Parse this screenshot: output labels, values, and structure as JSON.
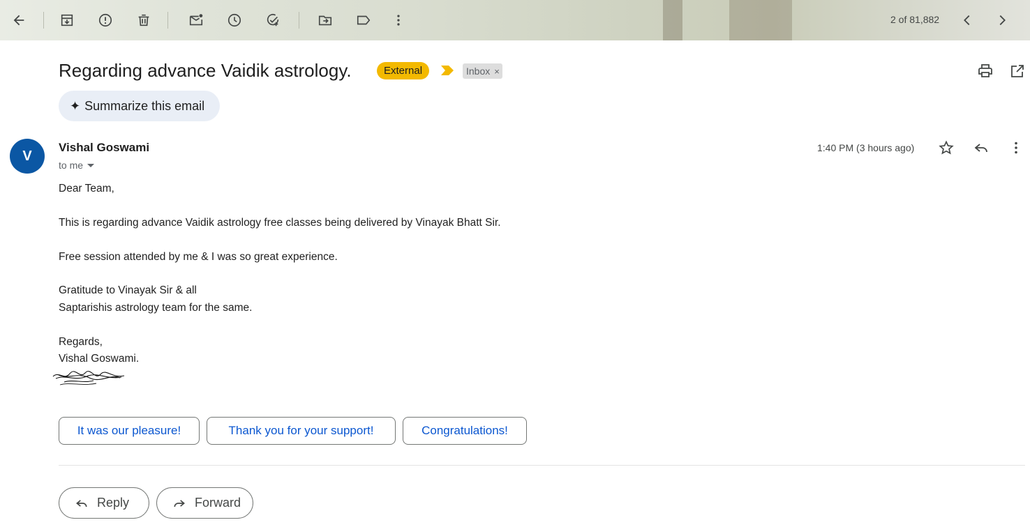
{
  "toolbar": {
    "pager": "2 of 81,882",
    "icons": [
      "back-icon",
      "archive-icon",
      "report-spam-icon",
      "delete-icon",
      "mark-unread-icon",
      "snooze-icon",
      "add-task-icon",
      "move-to-icon",
      "label-icon",
      "more-vert-icon",
      "newer-icon",
      "older-icon"
    ]
  },
  "email": {
    "subject": "Regarding advance Vaidik astrology.",
    "external_label": "External",
    "inbox_label": "Inbox",
    "inbox_remove": "×",
    "summarize_icon": "✦",
    "summarize_label": "Summarize this email",
    "sender_initial": "V",
    "sender_name": "Vishal Goswami",
    "recipient": "to me",
    "time": "1:40 PM (3 hours ago)",
    "body": {
      "line1": "Dear Team,",
      "line2": "This is regarding advance Vaidik astrology free classes being delivered by Vinayak Bhatt Sir.",
      "line3": "Free session attended by me & I was so great experience.",
      "line4": "Gratitude to Vinayak Sir & all",
      "line5": "Saptarishis astrology team for the same.",
      "line6": "Regards,",
      "line7": "Vishal Goswami."
    }
  },
  "smart_replies": [
    "It was our pleasure!",
    "Thank you for your support!",
    "Congratulations!"
  ],
  "actions": {
    "reply": "Reply",
    "forward": "Forward"
  },
  "colors": {
    "external": "#f3b900",
    "avatar": "#0b57a4",
    "link_blue": "#0b57d0",
    "chip_bg": "#e9eef6"
  }
}
